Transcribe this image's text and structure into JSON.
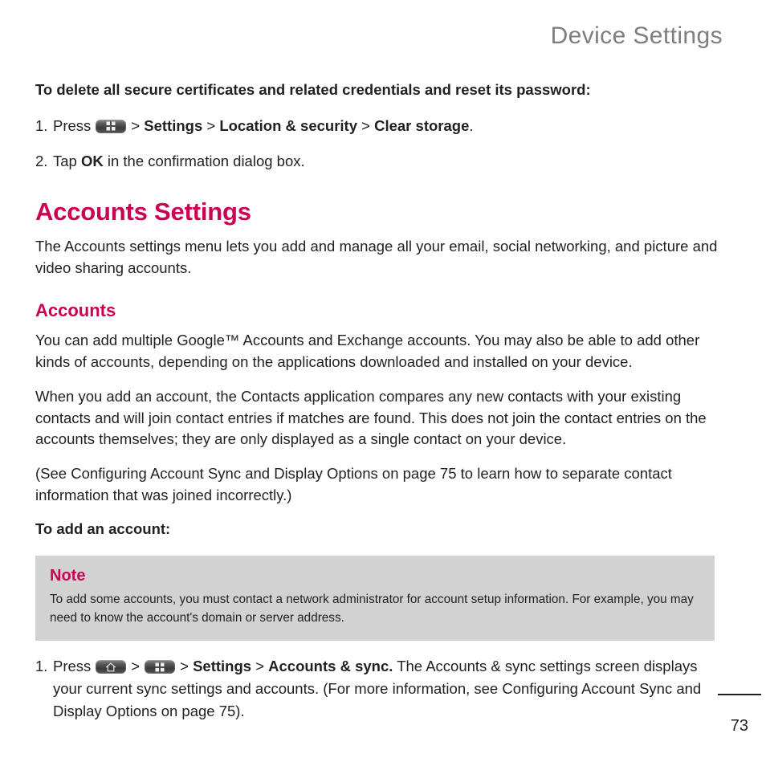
{
  "header": {
    "running_head": "Device Settings"
  },
  "content": {
    "lead": "To delete all secure certificates and related credentials and reset its password:",
    "steps_top": [
      {
        "num": "1.",
        "prefix": "Press",
        "icons": [
          "menu-key-icon"
        ],
        "sep1": ">",
        "bold1": "Settings",
        "sep2": ">",
        "bold2": "Location & security",
        "sep3": ">",
        "bold3": "Clear storage",
        "tail": "."
      },
      {
        "num": "2.",
        "prefix": "Tap",
        "bold1": "OK",
        "tail": "in the confirmation dialog box."
      }
    ],
    "section_title": "Accounts Settings",
    "section_intro": "The Accounts settings menu lets you add and manage all your email, social networking, and picture and video sharing accounts.",
    "subhead": "Accounts",
    "paragraphs": [
      "You can add multiple Google™ Accounts and Exchange accounts. You may also be able to add other kinds of accounts, depending on the applications downloaded and installed on your device.",
      "When you add an account, the Contacts application compares any new contacts with your existing contacts and will join contact entries if matches are found. This does not join the contact entries on the accounts themselves; they are only displayed as a single contact on your device.",
      "(See Configuring Account Sync and Display Options on page 75 to learn how to separate contact information that was joined incorrectly.)"
    ],
    "add_account_lead": "To add an account:",
    "note": {
      "title": "Note",
      "body": "To add some accounts, you must contact a network administrator for account setup information. For example, you may need to know the account's domain or server address."
    },
    "step_bottom": {
      "num": "1.",
      "prefix": "Press",
      "icons": [
        "home-key-icon",
        "menu-key-icon"
      ],
      "sep1": ">",
      "sep2": ">",
      "bold1": "Settings",
      "sep3": ">",
      "bold2": "Accounts & sync.",
      "tail": "The Accounts & sync settings screen displays your current sync settings and accounts. (For more information, see Configuring Account Sync and Display Options on page 75)."
    }
  },
  "footer": {
    "page_number": "73"
  },
  "colors": {
    "accent": "#cc0052",
    "header_gray": "#7e7e7e",
    "note_bg": "#d2d2d2",
    "text": "#231f20"
  }
}
